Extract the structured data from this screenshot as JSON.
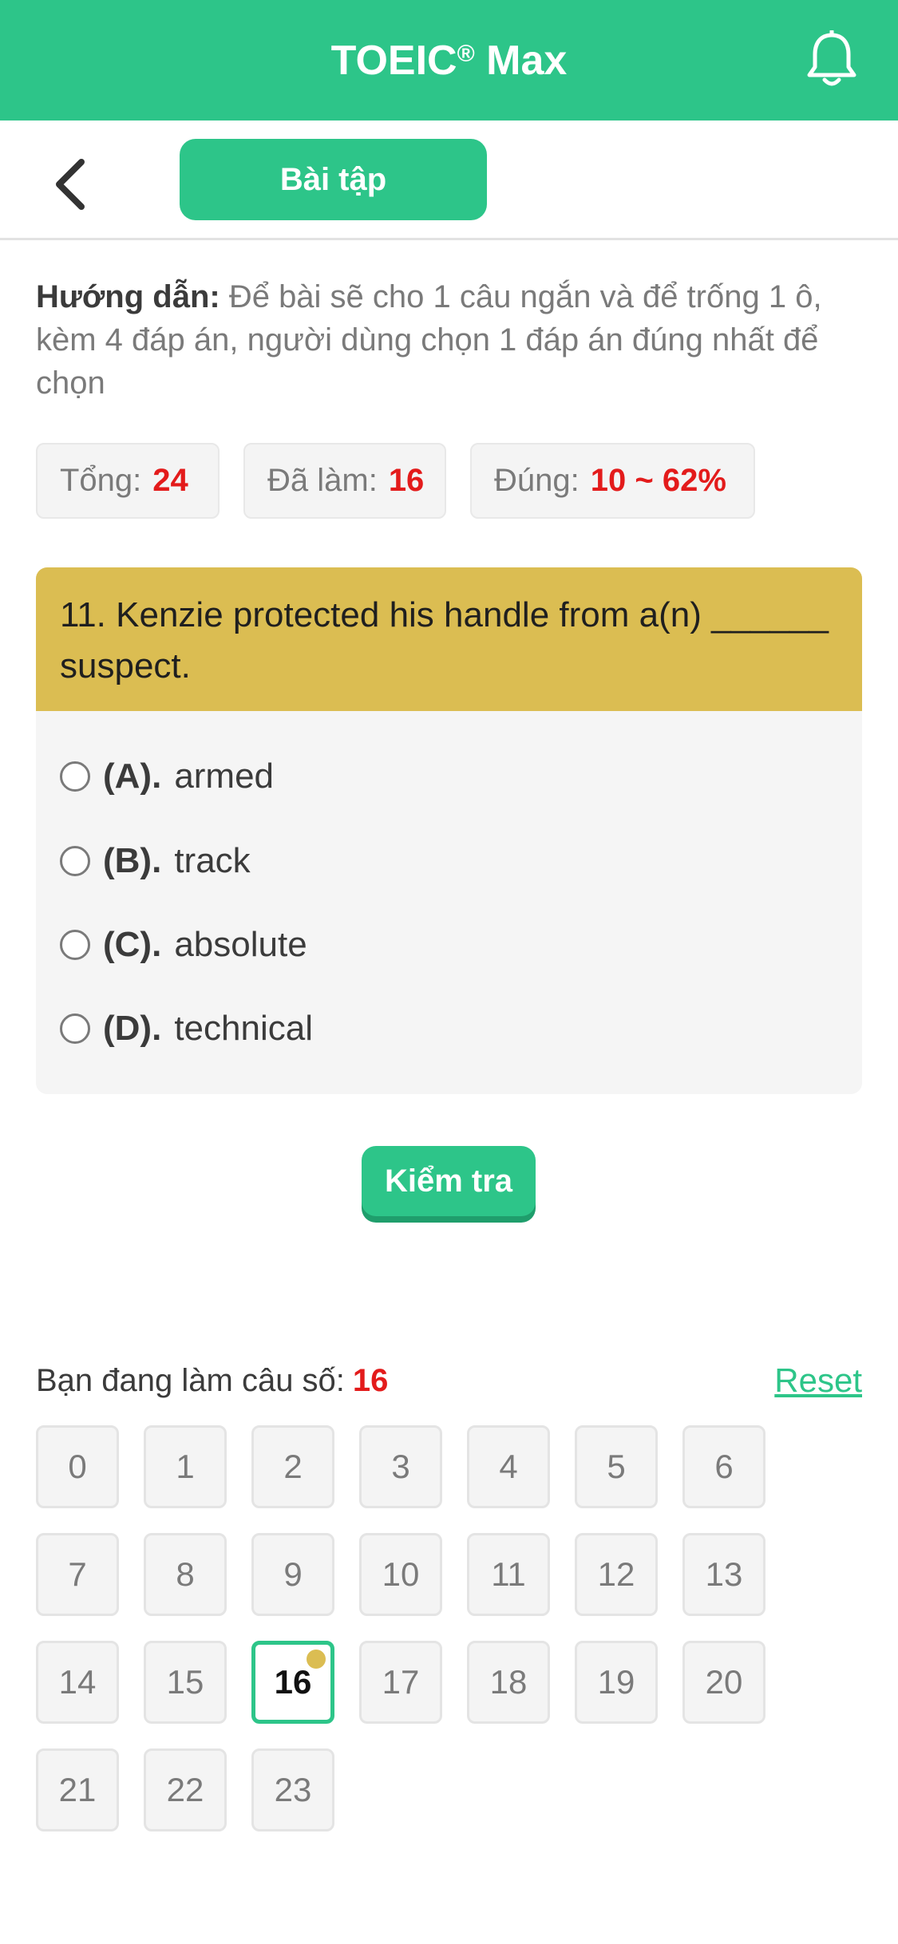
{
  "header": {
    "title": "TOEIC",
    "trademark": "®",
    "title_suffix": " Max"
  },
  "nav": {
    "tab_label": "Bài tập"
  },
  "instructions": {
    "label": "Hướng dẫn:",
    "text": " Để bài sẽ cho 1 câu ngắn và để trống 1 ô, kèm 4 đáp án, người dùng chọn 1 đáp án đúng nhất để chọn"
  },
  "stats": {
    "total_label": "Tổng:",
    "total_value": "24",
    "done_label": "Đã làm:",
    "done_value": "16",
    "correct_label": "Đúng:",
    "correct_value": "10 ~ 62%"
  },
  "question": {
    "text": "11. Kenzie protected his handle from a(n) ______ suspect.",
    "options": [
      {
        "letter": "(A).",
        "text": "armed"
      },
      {
        "letter": "(B).",
        "text": "track"
      },
      {
        "letter": "(C).",
        "text": "absolute"
      },
      {
        "letter": "(D).",
        "text": "technical"
      }
    ]
  },
  "check_button": "Kiểm tra",
  "progress": {
    "current_label": "Bạn đang làm câu số:",
    "current_value": "16",
    "reset_label": "Reset",
    "numbers": [
      "0",
      "1",
      "2",
      "3",
      "4",
      "5",
      "6",
      "7",
      "8",
      "9",
      "10",
      "11",
      "12",
      "13",
      "14",
      "15",
      "16",
      "17",
      "18",
      "19",
      "20",
      "21",
      "22",
      "23"
    ],
    "active_index": 16
  },
  "colors": {
    "brand": "#2dc589",
    "question_bg": "#dbbd52",
    "highlight": "#e31b1b"
  }
}
